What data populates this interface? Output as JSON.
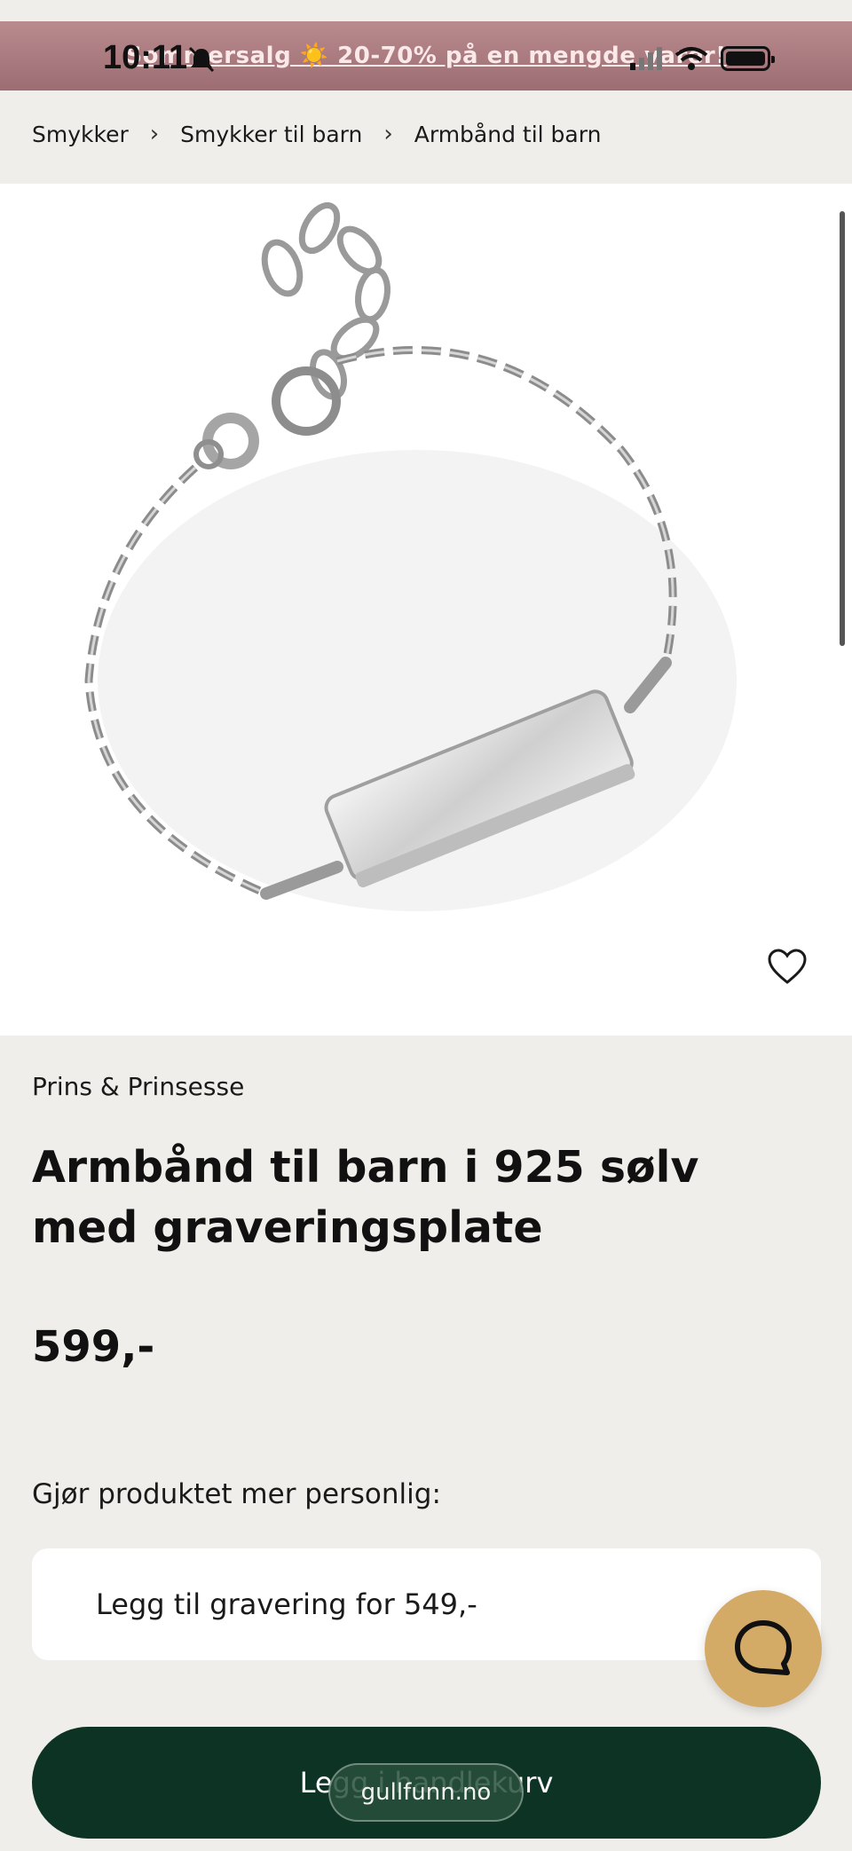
{
  "status_bar": {
    "time": "10:11",
    "icons": [
      "bell-muted-icon",
      "signal-icon",
      "wifi-icon",
      "battery-icon"
    ]
  },
  "promo": {
    "text": "Sommersalg ☀️ 20-70% på en mengde varer!"
  },
  "breadcrumb": {
    "items": [
      "Smykker",
      "Smykker til barn",
      "Armbånd til barn"
    ],
    "separator": "›"
  },
  "product": {
    "image_alt": "bracelet with engraving plate",
    "brand": "Prins & Prinsesse",
    "title": "Armbånd til barn i 925 sølv med graveringsplate",
    "price": "599,-",
    "favorite_icon": "heart-icon"
  },
  "personalize": {
    "label": "Gjør produktet mer personlig:",
    "option": "Legg til gravering for 549,-",
    "chevron": "›"
  },
  "actions": {
    "add_to_cart": "Legg i handlekurv",
    "chat_icon": "chat-bubble-icon"
  },
  "browser": {
    "url": "gullfunn.no"
  },
  "colors": {
    "promo_bg": "#a87a7f",
    "cart_button": "#0d3324",
    "chat_button": "#d4aa67",
    "page_bg": "#f0eeeb"
  }
}
